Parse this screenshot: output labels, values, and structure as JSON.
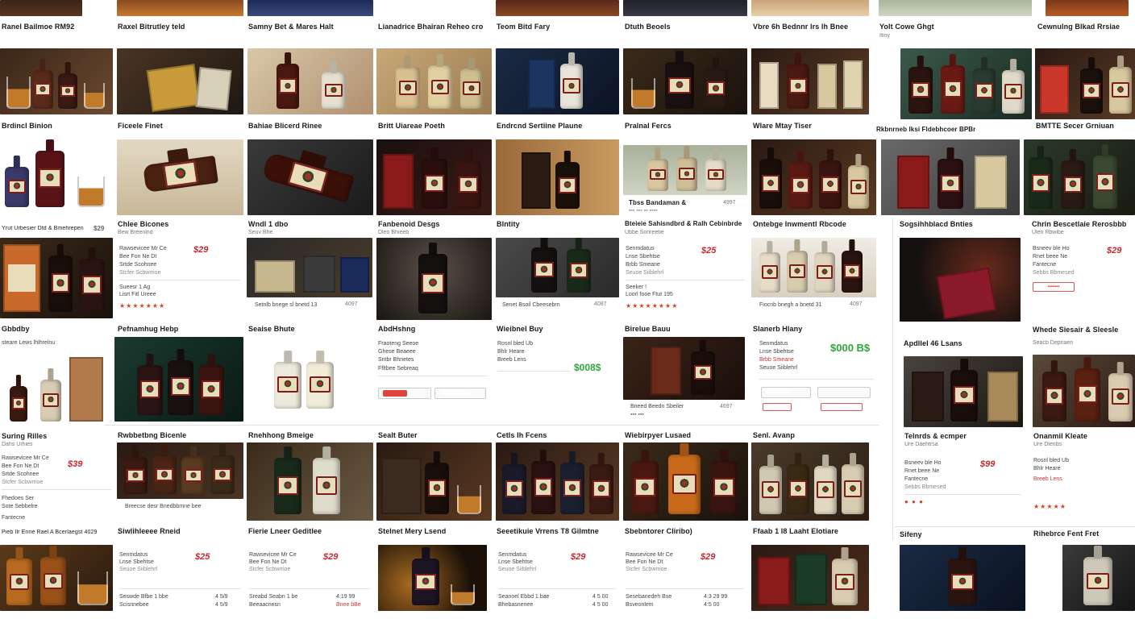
{
  "page": {
    "title": "Whisky listings grid"
  },
  "tiles": [
    {
      "id": "r0c0",
      "title": "Ranel Bailmoe RM92",
      "sub": ""
    },
    {
      "id": "r0c1",
      "title": "Raxel Bitrutley teld",
      "sub": ""
    },
    {
      "id": "r0c2",
      "title": "Samny Bet & Mares Halt",
      "sub": ""
    },
    {
      "id": "r0c3",
      "title": "Lianadrice Bhairan Reheo cro",
      "sub": ""
    },
    {
      "id": "r0c4",
      "title": "Teom Bitd Fary",
      "sub": ""
    },
    {
      "id": "r0c5",
      "title": "Dtuth Beoels",
      "sub": ""
    },
    {
      "id": "r0c6",
      "title": "Vbre 6h Bednnr lrs lh Bnee",
      "sub": ""
    },
    {
      "id": "r0c7",
      "title": "Yolt Cowe Ghgt",
      "sub": "Ifiny"
    },
    {
      "id": "r0c8",
      "title": "Cewnulng Blkad Rrsiae",
      "sub": ""
    },
    {
      "id": "r1c0",
      "title": "Brdincl Binion",
      "sub": ""
    },
    {
      "id": "r1c1",
      "title": "Ficeele Finet",
      "sub": ""
    },
    {
      "id": "r1c2",
      "title": "Bahiae Blicerd Rinee",
      "sub": ""
    },
    {
      "id": "r1c3",
      "title": "Britt Uiareae Poeth",
      "sub": ""
    },
    {
      "id": "r1c4",
      "title": "Endrcnd Sertiine Plaune",
      "sub": ""
    },
    {
      "id": "r1c5",
      "title": "Pralnal Fercs",
      "sub": ""
    },
    {
      "id": "r1c6",
      "title": "Wlare Mtay Tiser",
      "sub": ""
    },
    {
      "id": "r1c7",
      "title": "Rkbnrneb lksi Fldebhcoer BPBr",
      "sub": ""
    },
    {
      "id": "r1c8",
      "title": "BMTTE Secer Grniuan",
      "sub": ""
    },
    {
      "id": "r2c0",
      "title": "Yrut Urbesier Dtd & Bmehrepen",
      "price": "$29",
      "sub": ""
    },
    {
      "id": "r2c1",
      "title": "Chlee Bicones",
      "sub": "Bew Breenlnd"
    },
    {
      "id": "r2c2",
      "title": "Wndl 1 dbo",
      "sub": "Seuv Bhe"
    },
    {
      "id": "r2c3",
      "title": "Fanbenoid Desgs",
      "sub": "Dleo Bhieeb"
    },
    {
      "id": "r2c4",
      "title": "Blntity",
      "sub": ""
    },
    {
      "id": "r2c5",
      "title": "Bteieie Sahisndbrd & Ralh Cebinbrde",
      "sub": "Ubbe Sonreetie"
    },
    {
      "id": "r2c6",
      "title": "Ontebge Inwmentl Rbcode",
      "sub": ""
    },
    {
      "id": "r2c7",
      "title": "Sogsihhblacd Bnties",
      "sub": ""
    },
    {
      "id": "r2c8",
      "title": "Chrin Bescetlaie Rerosbbb",
      "sub": "Ulen Rbwibe"
    },
    {
      "id": "r3c0",
      "title": "Gbbdby",
      "sub": "steare Lews lhlhrelnu"
    },
    {
      "id": "r3c1",
      "title": "Pefnamhug Hebp",
      "sub": ""
    },
    {
      "id": "r3c2",
      "title": "Seaise Bhute",
      "sub": ""
    },
    {
      "id": "r3c3",
      "title": "AbdHshng",
      "sub": ""
    },
    {
      "id": "r3c4",
      "title": "Wieibnel Buy",
      "sub": ""
    },
    {
      "id": "r3c5",
      "title": "Birelue Bauu",
      "sub": ""
    },
    {
      "id": "r3c6",
      "title": "Slanerb Hlany",
      "sub": ""
    },
    {
      "id": "r3c7",
      "title": "Apdllel 46 Lsans",
      "sub": ""
    },
    {
      "id": "r3c8",
      "title": "Whede Siesair & Sleesle",
      "sub": "Seacb Depnaen"
    },
    {
      "id": "r4c0",
      "title": "Suring Rilles",
      "sub": "Dahs Urhies"
    },
    {
      "id": "r4c1",
      "title": "Rwbbetbng Bicenle",
      "sub": ""
    },
    {
      "id": "r4c2",
      "title": "Rnehhong Bmeige",
      "sub": ""
    },
    {
      "id": "r4c3",
      "title": "Sealt Buter",
      "sub": ""
    },
    {
      "id": "r4c4",
      "title": "Cetls Ih Fcens",
      "sub": ""
    },
    {
      "id": "r4c5",
      "title": "Wiebirpyer Lusaed",
      "sub": ""
    },
    {
      "id": "r4c6",
      "title": "Senl. Avanp",
      "sub": ""
    },
    {
      "id": "r4c7",
      "title": "Telnrds & ecmper",
      "sub": "Ure Daehtrsa"
    },
    {
      "id": "r4c8",
      "title": "Onanmil Kleate",
      "sub": "Ure Dleribs"
    },
    {
      "id": "r5c0",
      "title": "Pieb Ilr Enrie Rael A Bcerlaegst 4029",
      "sub": ""
    },
    {
      "id": "r5c1",
      "title": "Siwlihleeee Rneid",
      "sub": ""
    },
    {
      "id": "r5c2",
      "title": "Fierie Lneer Geditlee",
      "sub": ""
    },
    {
      "id": "r5c3",
      "title": "Stelnet Mery Lsend",
      "sub": ""
    },
    {
      "id": "r5c4",
      "title": "Seeetikuie Vrrens T8 Gilmtne",
      "sub": ""
    },
    {
      "id": "r5c5",
      "title": "Sbebntorer Cliribo)",
      "sub": ""
    },
    {
      "id": "r5c6",
      "title": "Ffaab 1 l8 Laaht Elotiare",
      "sub": ""
    },
    {
      "id": "r5c7",
      "title": "Sifeny",
      "sub": ""
    },
    {
      "id": "r5c8",
      "title": "Rihebrce Fent Fret",
      "sub": ""
    }
  ],
  "prices": {
    "a": "$29",
    "b": "$25",
    "c": "$29",
    "d": "$39",
    "e": "$25",
    "f": "$99",
    "g": "$29",
    "h": "$29",
    "i": "$29",
    "j": "$29",
    "green1": "$008$",
    "green2": "$000 B$"
  },
  "cards": {
    "k1": {
      "l1": "Rawsevicee Mr Ce",
      "l2": "Bee Fon Ne Dt",
      "l3": "Srtde Scohnee",
      "l4": "Stcfer Scbwrrioe",
      "r1": "Sueesr 1 Ag",
      "r2": "Lisrt Fitl Ureee",
      "rating": "★★★★★★★"
    },
    "k2": {
      "l1": "Senmdatus",
      "l2": "Lnse Sbehtse",
      "l3": "Brbb Smeane",
      "l4": "Seuoe Siiblehrl",
      "r1": "Seeker !",
      "r2": "Loorl fooe Ftut 195",
      "rating": "★★★★★★★★"
    },
    "k3": {
      "l1": "Bsneev ble Ho",
      "l2": "Rnet beee Ne",
      "l3": "Fantecne",
      "l4": "Sebbs Bbmesed",
      "r1": "Fhedoes Ser",
      "r2": "Sote Sebbelre"
    },
    "k4": {
      "l1": "Fraoteng Seeoe",
      "l2": "Ghese Beaeee",
      "l3": "Sntbr Bhnetes",
      "l4": "Ffltbee Sebreaq"
    },
    "k5": {
      "l1": "Rosnl bled Ub",
      "l2": "Bhlr Heare",
      "l3": "Breeb Lens"
    }
  },
  "captions": {
    "ov1": "Tbss Bandaman &",
    "ov1s": "4997",
    "c1": "Setnlb bnege sl bnetd 13",
    "c1s": "4097",
    "c2": "Senet Bsoil Cbeesebrn",
    "c2s": "4087",
    "c3": "Fiocnb bnegh a bnetd 31",
    "c3s": "4097",
    "c4": "Bneed Beedn Sbeiler",
    "c4s": "4697",
    "c5": "Breecse desr Bnedbbmne bee",
    "c5s": "",
    "t1": "Seswde Bfbe 1 bbe",
    "t1s": "4 5/9",
    "t1b": "Scisnnebee",
    "t1bs": "4 5/9",
    "t2": "Sreabd Seabn 1 be",
    "t2s": "4:19 99",
    "t2b": "Beeaacnesn",
    "t2bs": "Bnee bBe",
    "t3": "Seanoel Ebbd 1.bae",
    "t3s": "4 5 00",
    "t3b": "Bhebasnenee",
    "t3bs": "4 5 00",
    "t4": "Sesebanedeh Bse",
    "t4s": "4:3 29 99",
    "t4b": "Bsveonlem",
    "t4bs": "4:5 00"
  }
}
